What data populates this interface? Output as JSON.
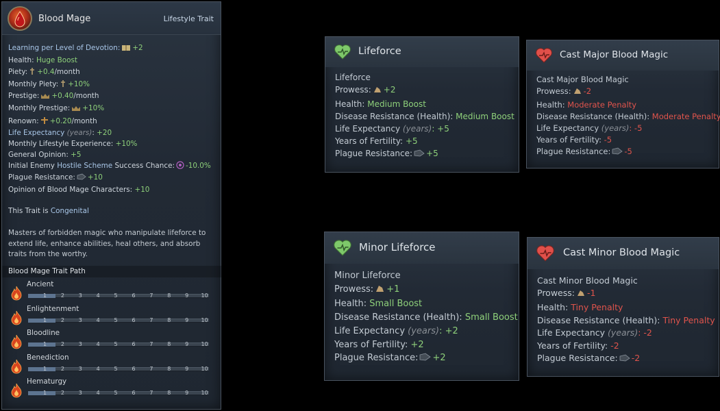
{
  "main": {
    "title": "Blood Mage",
    "type": "Lifestyle Trait",
    "learning_label": "Learning per Level of Devotion:",
    "learning_value": "+2",
    "health_label": "Health:",
    "health_value": "Huge Boost",
    "piety_label": "Piety:",
    "piety_value": "+0.4",
    "piety_unit": "/month",
    "monthly_piety_label": "Monthly Piety:",
    "monthly_piety_value": "+10%",
    "prestige_label": "Prestige:",
    "prestige_value": "+0.40",
    "prestige_unit": "/month",
    "monthly_prestige_label": "Monthly Prestige:",
    "monthly_prestige_value": "+10%",
    "renown_label": "Renown:",
    "renown_value": "+0.20",
    "renown_unit": "/month",
    "life_exp_label": "Life Expectancy",
    "life_exp_unit": "(years)",
    "life_exp_value": "+20",
    "lifestyle_xp_label": "Monthly Lifestyle Experience:",
    "lifestyle_xp_value": "+10%",
    "general_opinion_label": "General Opinion:",
    "general_opinion_value": "+5",
    "scheme_label_a": "Initial Enemy",
    "scheme_label_b": "Hostile Scheme",
    "scheme_label_c": "Success Chance:",
    "scheme_value": "-10.0%",
    "plague_label": "Plague Resistance:",
    "plague_value": "+10",
    "opinion_label": "Opinion of Blood Mage Characters:",
    "opinion_value": "+10",
    "congenital_label": "This Trait is",
    "congenital_value": "Congenital",
    "description": "Masters of forbidden magic who manipulate lifeforce to extend life, enhance abilities, heal others, and absorb traits from the worthy.",
    "path_title": "Blood Mage Trait Path",
    "levels": [
      "1",
      "2",
      "3",
      "4",
      "5",
      "6",
      "7",
      "8",
      "9",
      "10"
    ],
    "tracks": [
      {
        "name": "Ancient",
        "current_level": 2
      },
      {
        "name": "Enlightenment",
        "current_level": 2
      },
      {
        "name": "Bloodline",
        "current_level": 2
      },
      {
        "name": "Benediction",
        "current_level": 2
      },
      {
        "name": "Hematurgy",
        "current_level": 2
      }
    ]
  },
  "cards": {
    "lifeforce": {
      "title": "Lifeforce",
      "name": "Lifeforce",
      "prowess_label": "Prowess:",
      "prowess_value": "+2",
      "health_label": "Health:",
      "health_value": "Medium Boost",
      "disease_label": "Disease Resistance (Health):",
      "disease_value": "Medium Boost",
      "life_label": "Life Expectancy",
      "life_unit": "(years)",
      "life_value": ": +5",
      "fert_label": "Years of Fertility:",
      "fert_value": "+5",
      "plague_label": "Plague Resistance:",
      "plague_value": "+5"
    },
    "minor_lifeforce": {
      "title": "Minor Lifeforce",
      "name": "Minor Lifeforce",
      "prowess_label": "Prowess:",
      "prowess_value": "+1",
      "health_label": "Health:",
      "health_value": "Small Boost",
      "disease_label": "Disease Resistance (Health):",
      "disease_value": "Small Boost",
      "life_label": "Life Expectancy",
      "life_unit": "(years)",
      "life_value": ": +2",
      "fert_label": "Years of Fertility:",
      "fert_value": "+2",
      "plague_label": "Plague Resistance:",
      "plague_value": "+2"
    },
    "major_blood": {
      "title": "Cast Major Blood Magic",
      "name": "Cast Major Blood Magic",
      "prowess_label": "Prowess:",
      "prowess_value": "-2",
      "health_label": "Health:",
      "health_value": "Moderate Penalty",
      "disease_label": "Disease Resistance (Health):",
      "disease_value": "Moderate Penalty",
      "life_label": "Life Expectancy",
      "life_unit": "(years)",
      "life_value": ": -5",
      "fert_label": "Years of Fertility:",
      "fert_value": "-5",
      "plague_label": "Plague Resistance:",
      "plague_value": "-5"
    },
    "minor_blood": {
      "title": "Cast Minor Blood Magic",
      "name": "Cast Minor Blood Magic",
      "prowess_label": "Prowess:",
      "prowess_value": "-1",
      "health_label": "Health:",
      "health_value": "Tiny Penalty",
      "disease_label": "Disease Resistance (Health):",
      "disease_value": "Tiny Penalty",
      "life_label": "Life Expectancy",
      "life_unit": "(years)",
      "life_value": ": -2",
      "fert_label": "Years of Fertility:",
      "fert_value": "-2",
      "plague_label": "Plague Resistance:",
      "plague_value": "-2"
    }
  }
}
